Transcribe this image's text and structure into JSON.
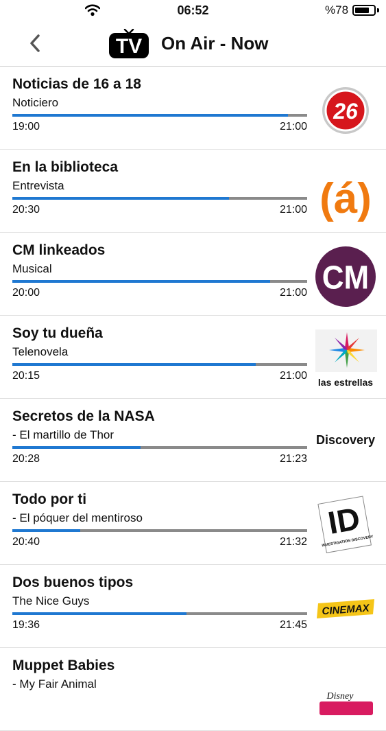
{
  "status_bar": {
    "time": "06:52",
    "battery": "%78",
    "battery_level": 0.78
  },
  "nav": {
    "title": "On Air - Now",
    "logo_text": "TV"
  },
  "programs": [
    {
      "title": "Noticias de 16 a 18",
      "subtitle": "Noticiero",
      "start": "19:00",
      "end": "21:00",
      "progress": 0.935,
      "channel_icon": "canal-26-logo",
      "channel_text": "26"
    },
    {
      "title": "En la biblioteca",
      "subtitle": "Entrevista",
      "start": "20:30",
      "end": "21:00",
      "progress": 0.735,
      "channel_icon": "canal-a-logo",
      "channel_text": "(á)"
    },
    {
      "title": "CM linkeados",
      "subtitle": "Musical",
      "start": "20:00",
      "end": "21:00",
      "progress": 0.875,
      "channel_icon": "cm-logo",
      "channel_text": "CM"
    },
    {
      "title": "Soy tu dueña",
      "subtitle": "Telenovela",
      "start": "20:15",
      "end": "21:00",
      "progress": 0.825,
      "channel_icon": "las-estrellas-logo",
      "channel_text": "las estrellas"
    },
    {
      "title": "Secretos de la NASA",
      "subtitle": "- El martillo de Thor",
      "start": "20:28",
      "end": "21:23",
      "progress": 0.435,
      "channel_icon": "discovery-logo",
      "channel_text": "Discovery"
    },
    {
      "title": "Todo por ti",
      "subtitle": "- El póquer del mentiroso",
      "start": "20:40",
      "end": "21:32",
      "progress": 0.23,
      "channel_icon": "investigation-discovery-logo",
      "channel_text": "ID",
      "channel_subtext": "INVESTIGATION DISCOVERY"
    },
    {
      "title": "Dos buenos tipos",
      "subtitle": "The Nice Guys",
      "start": "19:36",
      "end": "21:45",
      "progress": 0.59,
      "channel_icon": "cinemax-logo",
      "channel_text": "CINEMAX"
    },
    {
      "title": "Muppet Babies",
      "subtitle": "- My Fair Animal",
      "start": "",
      "end": "",
      "progress": null,
      "channel_icon": "disney-junior-logo",
      "channel_text": "Disney"
    }
  ]
}
